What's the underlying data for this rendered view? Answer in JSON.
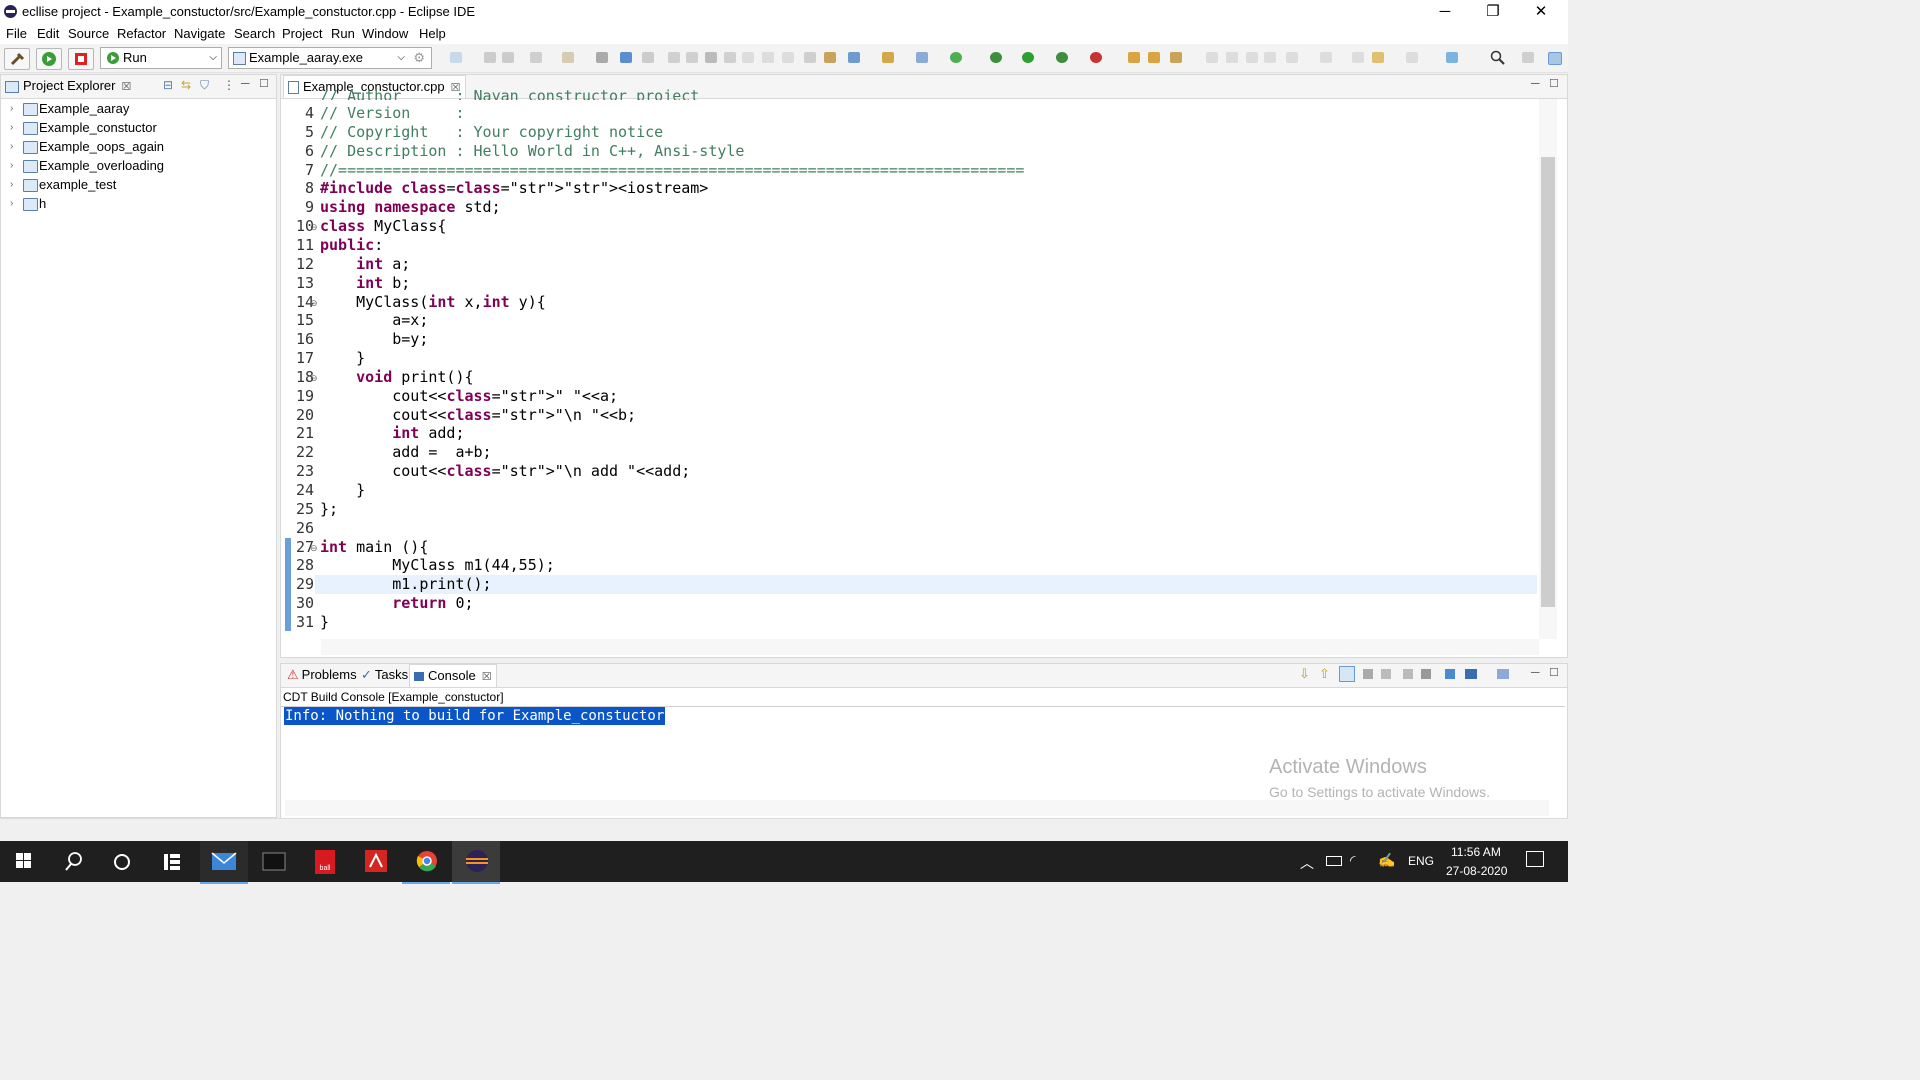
{
  "window": {
    "title": "ecllise project - Example_constuctor/src/Example_constuctor.cpp - Eclipse IDE",
    "minimize": "─",
    "restore": "❐",
    "close": "✕"
  },
  "menu": [
    "File",
    "Edit",
    "Source",
    "Refactor",
    "Navigate",
    "Search",
    "Project",
    "Run",
    "Window",
    "Help"
  ],
  "toolbar": {
    "launch_mode": "Run",
    "launch_config": "Example_aaray.exe"
  },
  "project_explorer": {
    "title": "Project Explorer",
    "close": "☒",
    "items": [
      "Example_aaray",
      "Example_constuctor",
      "Example_oops_again",
      "Example_overloading",
      "example_test",
      "h"
    ]
  },
  "editor": {
    "tab_title": "Example_constuctor.cpp",
    "close": "☒",
    "line_numbers": [
      "4",
      "5",
      "6",
      "7",
      "8",
      "9",
      "10",
      "11",
      "12",
      "13",
      "14",
      "15",
      "16",
      "17",
      "18",
      "19",
      "20",
      "21",
      "22",
      "23",
      "24",
      "25",
      "26",
      "27",
      "28",
      "29",
      "30",
      "31"
    ],
    "partial_top_line": "// Author      : Nayan constructor project",
    "lines": [
      "// Version     :",
      "// Copyright   : Your copyright notice",
      "// Description : Hello World in C++, Ansi-style",
      "//============================================================================",
      "#include <iostream>",
      "using namespace std;",
      "class MyClass{",
      "public:",
      "    int a;",
      "    int b;",
      "    MyClass(int x,int y){",
      "        a=x;",
      "        b=y;",
      "    }",
      "    void print(){",
      "        cout<<\" \"<<a;",
      "        cout<<\"\\n \"<<b;",
      "        int add;",
      "        add =  a+b;",
      "        cout<<\"\\n add \"<<add;",
      "    }",
      "};",
      "",
      "int main (){",
      "        MyClass m1(44,55);",
      "        m1.print();",
      "        return 0;",
      "}"
    ]
  },
  "bottom_panel": {
    "tabs": [
      "Problems",
      "Tasks",
      "Console"
    ],
    "close": "☒",
    "console_title": "CDT Build Console [Example_constuctor]",
    "console_output": "Info: Nothing to build for Example_constuctor"
  },
  "watermark": {
    "line1": "Activate Windows",
    "line2": "Go to Settings to activate Windows."
  },
  "taskbar": {
    "language": "ENG",
    "time": "11:56 AM",
    "date": "27-08-2020"
  }
}
